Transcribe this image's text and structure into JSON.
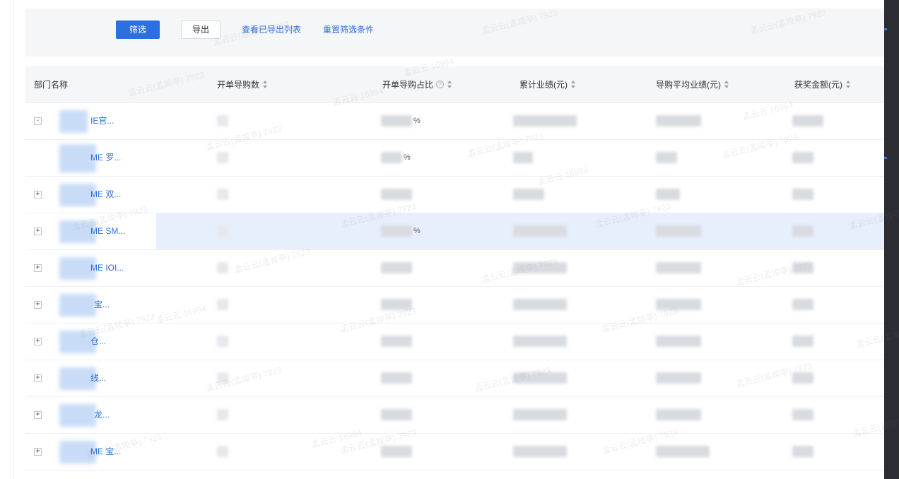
{
  "toolbar": {
    "filter_label": "筛选",
    "export_label": "导出",
    "view_exported_label": "查看已导出列表",
    "reset_filter_label": "重置筛选条件"
  },
  "table": {
    "columns": [
      {
        "label": "部门名称",
        "sortable": false,
        "help": false
      },
      {
        "label": "开单导购数",
        "sortable": true,
        "help": false
      },
      {
        "label": "开单导购占比",
        "sortable": true,
        "help": true
      },
      {
        "label": "累计业绩(元)",
        "sortable": true,
        "help": false
      },
      {
        "label": "导购平均业绩(元)",
        "sortable": true,
        "help": false
      },
      {
        "label": "获奖金额(元)",
        "sortable": true,
        "help": false
      }
    ],
    "rows": [
      {
        "toggle": "-",
        "name_visible": "IE官...",
        "selected": false,
        "cell_hints": [
          "",
          "%",
          "",
          "",
          ""
        ]
      },
      {
        "toggle": "",
        "name_visible": "ME 罗...",
        "selected": false,
        "cell_hints": [
          "",
          "%",
          "",
          "",
          ""
        ]
      },
      {
        "toggle": "+",
        "name_visible": "ME 双...",
        "selected": false,
        "cell_hints": [
          "",
          "",
          "",
          "",
          ""
        ]
      },
      {
        "toggle": "+",
        "name_visible": "ME SM...",
        "selected": true,
        "cell_hints": [
          "",
          "%",
          "",
          "",
          ""
        ]
      },
      {
        "toggle": "+",
        "name_visible": "ME IOI...",
        "selected": false,
        "cell_hints": [
          "",
          "",
          "",
          "",
          ""
        ]
      },
      {
        "toggle": "+",
        "name_visible": "宝...",
        "selected": false,
        "cell_hints": [
          "",
          "",
          "",
          "",
          ""
        ]
      },
      {
        "toggle": "+",
        "name_visible": "仓...",
        "selected": false,
        "cell_hints": [
          "",
          "",
          "",
          "",
          ""
        ]
      },
      {
        "toggle": "+",
        "name_visible": "线...",
        "selected": false,
        "cell_hints": [
          "",
          "",
          "",
          "",
          ""
        ]
      },
      {
        "toggle": "+",
        "name_visible": "龙...",
        "selected": false,
        "cell_hints": [
          "",
          "",
          "",
          "",
          ""
        ]
      },
      {
        "toggle": "+",
        "name_visible": "ME 宝...",
        "selected": false,
        "cell_hints": [
          "",
          "",
          "",
          "",
          ""
        ]
      }
    ]
  },
  "watermarks": [
    "孟云云(孟竣亭) 7923",
    "孟云云 16994"
  ],
  "colors": {
    "primary": "#2d6fe0",
    "header_bg": "#f5f6f8",
    "selected_row": "#e7effc"
  }
}
